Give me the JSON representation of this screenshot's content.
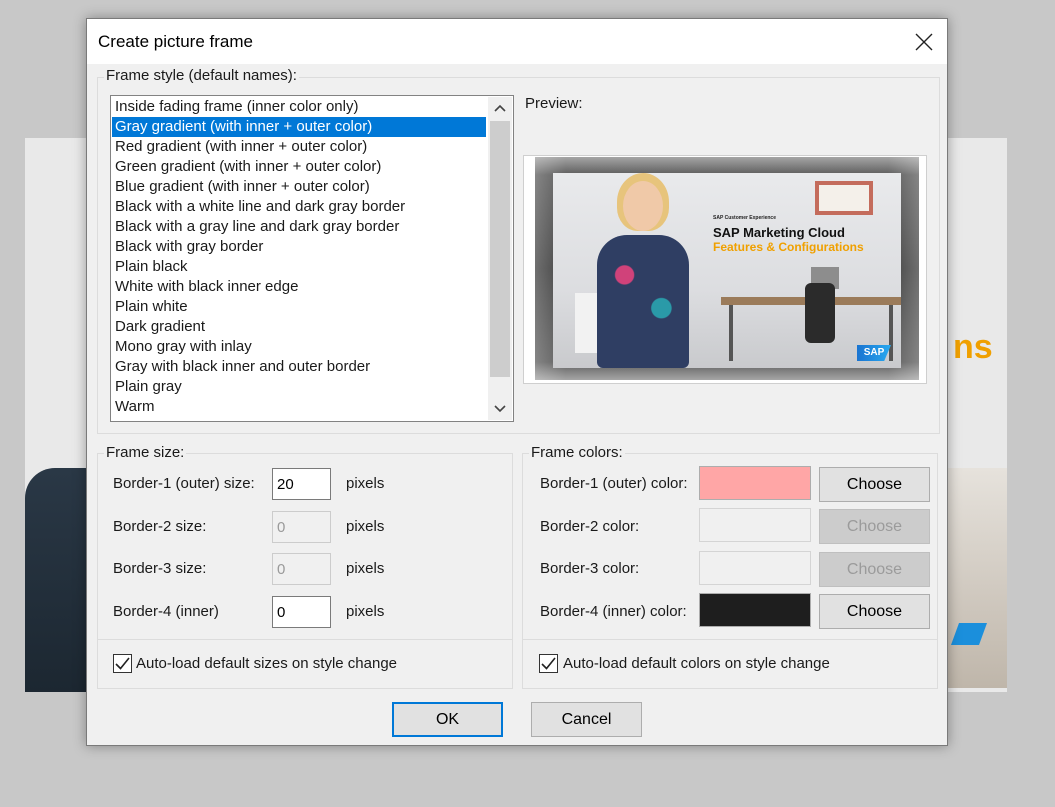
{
  "background": {
    "fragment_text": "ns"
  },
  "dialog": {
    "title": "Create picture frame",
    "close_icon": "close-icon"
  },
  "frame_style": {
    "legend": "Frame style (default names):",
    "items": [
      "Inside fading frame (inner color only)",
      "Gray gradient (with inner + outer color)",
      "Red gradient (with inner + outer color)",
      "Green gradient (with inner + outer color)",
      "Blue gradient (with inner + outer color)",
      "Black with a white line and dark gray border",
      "Black with a gray line and dark gray border",
      "Black with gray border",
      "Plain black",
      "White with black inner edge",
      "Plain white",
      "Dark gradient",
      "Mono gray with inlay",
      "Gray with black inner and outer border",
      "Plain gray",
      "Warm"
    ],
    "selected_index": 1,
    "preview_label": "Preview:",
    "preview": {
      "subtitle": "SAP Customer Experience",
      "title": "SAP Marketing Cloud",
      "title2": "Features & Configurations",
      "logo": "SAP"
    }
  },
  "frame_size": {
    "legend": "Frame size:",
    "unit": "pixels",
    "border1_label": "Border-1 (outer) size:",
    "border1_value": "20",
    "border2_label": "Border-2 size:",
    "border2_value": "0",
    "border3_label": "Border-3 size:",
    "border3_value": "0",
    "border4_label": "Border-4 (inner)",
    "border4_value": "0",
    "autoload_label": "Auto-load default sizes on style change",
    "autoload_checked": true
  },
  "frame_colors": {
    "legend": "Frame colors:",
    "border1_label": "Border-1 (outer) color:",
    "border1_color": "#ffa6a6",
    "border2_label": "Border-2 color:",
    "border2_color": "#f0f0f0",
    "border3_label": "Border-3 color:",
    "border3_color": "#f0f0f0",
    "border4_label": "Border-4 (inner) color:",
    "border4_color": "#1e1e1e",
    "choose_label": "Choose",
    "autoload_label": "Auto-load default colors on style change",
    "autoload_checked": true
  },
  "buttons": {
    "ok": "OK",
    "cancel": "Cancel"
  }
}
